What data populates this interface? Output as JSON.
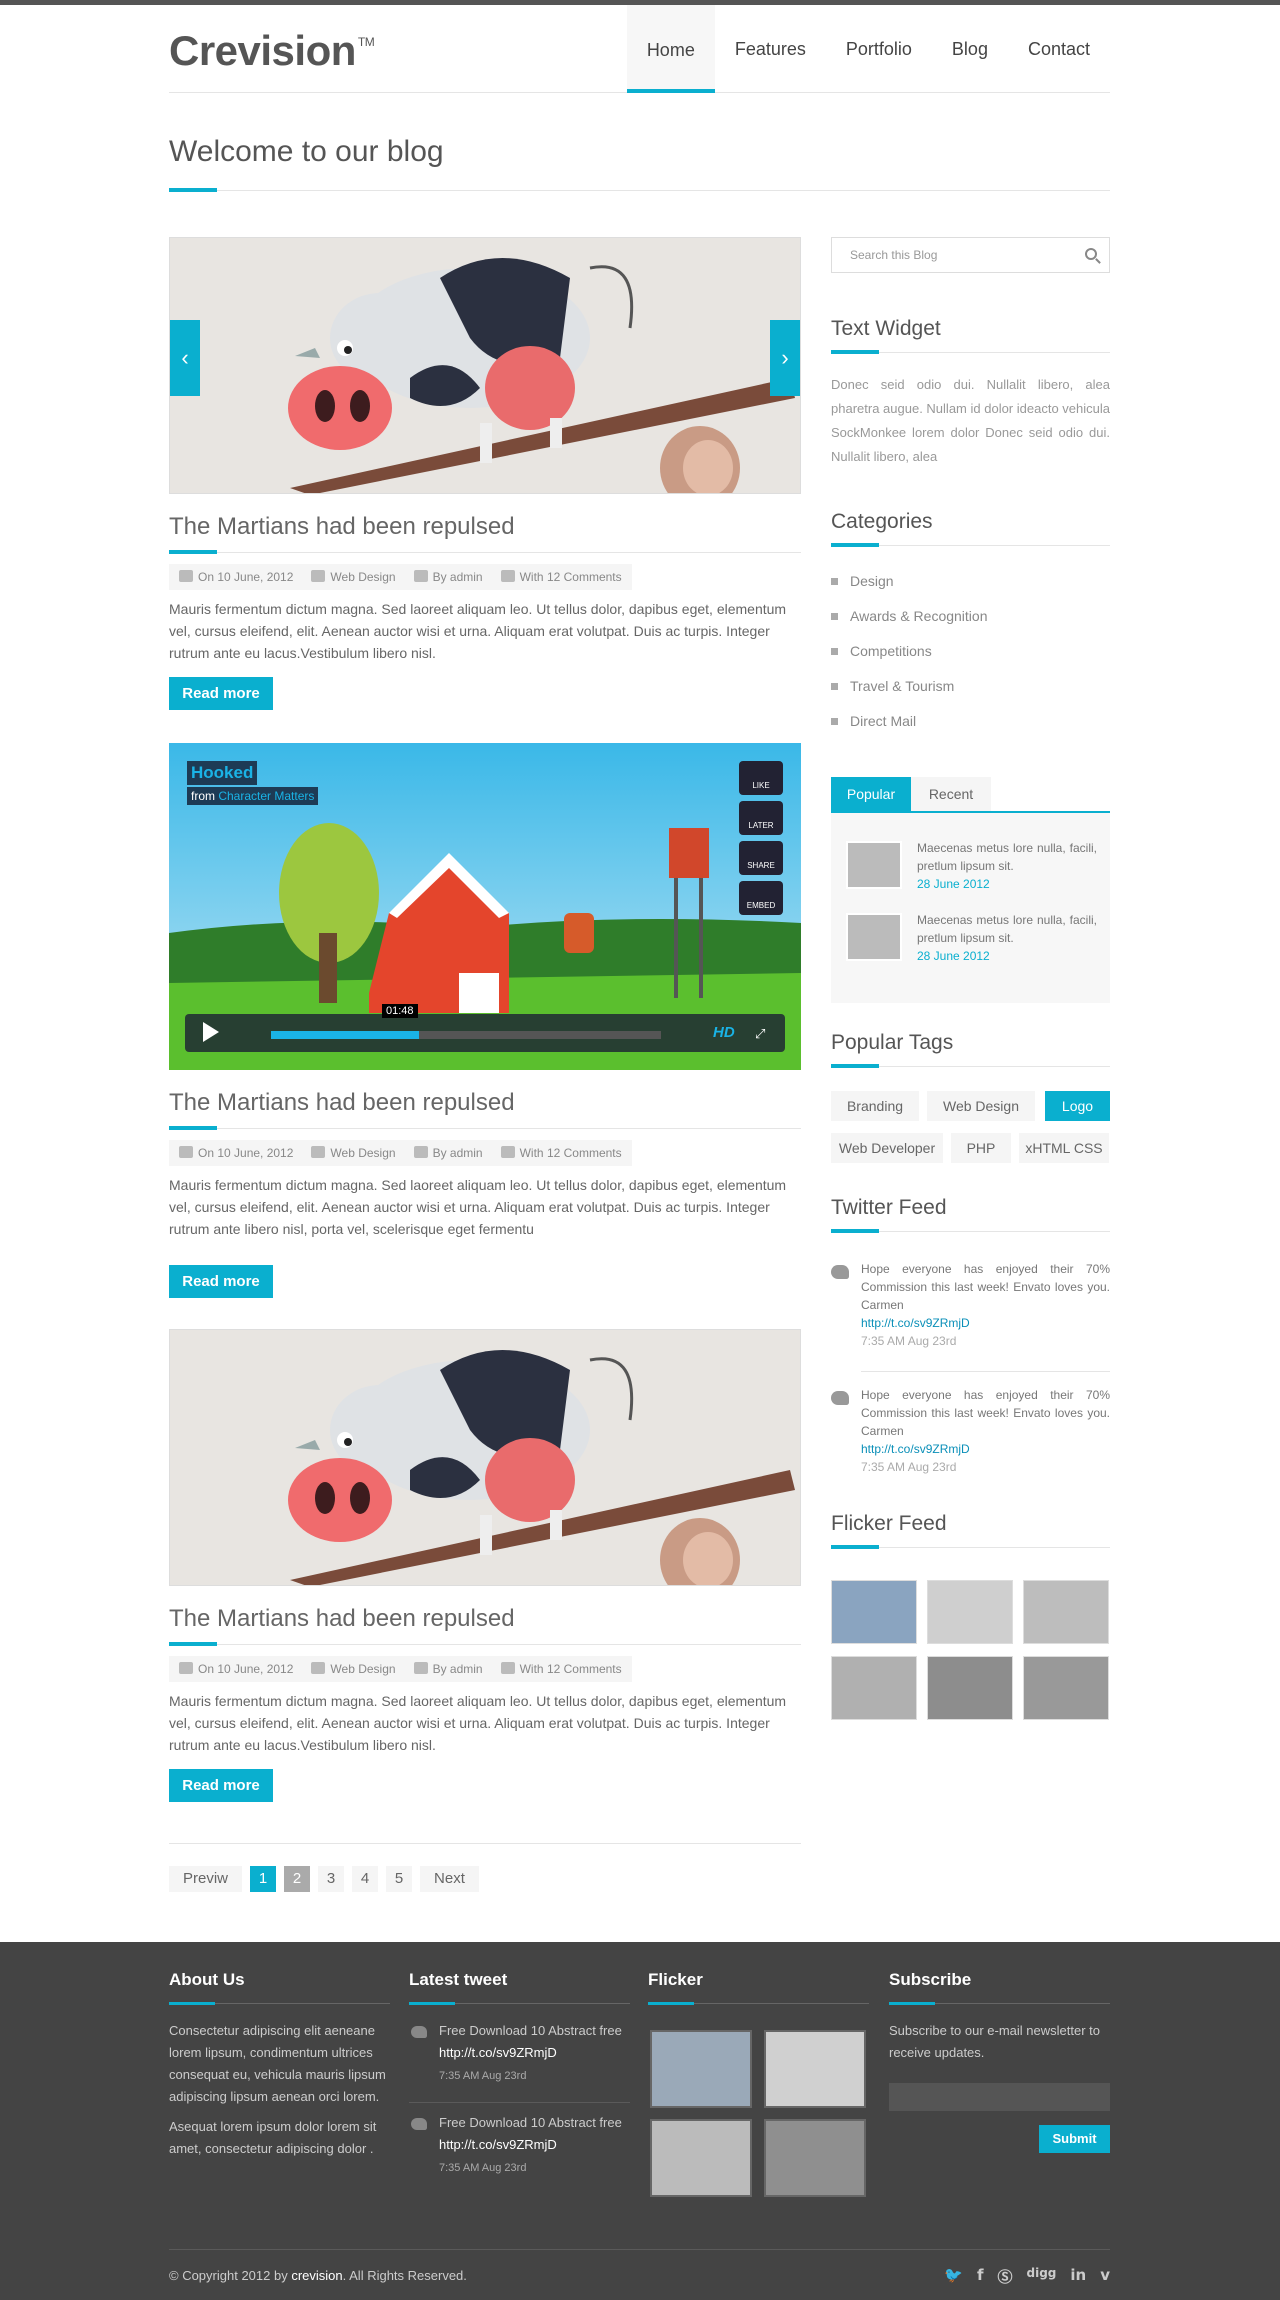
{
  "header": {
    "logo": "Crevision",
    "logo_mark": "TM",
    "nav": [
      "Home",
      "Features",
      "Portfolio",
      "Blog",
      "Contact"
    ],
    "active_nav": "Home"
  },
  "page_title": "Welcome to our blog",
  "posts": [
    {
      "title": "The Martians had been repulsed",
      "date": "On 10 June, 2012",
      "category": "Web Design",
      "author": "By admin",
      "comments": "With 12 Comments",
      "excerpt": "Mauris fermentum dictum magna. Sed laoreet aliquam leo. Ut tellus dolor, dapibus eget, elementum vel, cursus eleifend, elit. Aenean auctor wisi et urna. Aliquam erat volutpat. Duis ac turpis. Integer rutrum ante eu lacus.Vestibulum libero nisl.",
      "read_more": "Read more"
    },
    {
      "title": "The Martians had been repulsed",
      "date": "On 10 June, 2012",
      "category": "Web Design",
      "author": "By admin",
      "comments": "With 12 Comments",
      "excerpt": "Mauris fermentum dictum magna. Sed laoreet aliquam leo. Ut tellus dolor, dapibus eget, elementum vel, cursus eleifend, elit. Aenean auctor wisi et urna. Aliquam erat volutpat. Duis ac turpis. Integer rutrum ante libero nisl, porta vel, scelerisque eget fermentu",
      "read_more": "Read more",
      "video": {
        "title": "Hooked",
        "from": "from",
        "channel": "Character Matters",
        "time": "01:48",
        "buttons": [
          "LIKE",
          "LATER",
          "SHARE",
          "EMBED"
        ],
        "hd": "HD"
      }
    },
    {
      "title": "The Martians had been repulsed",
      "date": "On 10 June, 2012",
      "category": "Web Design",
      "author": "By admin",
      "comments": "With 12 Comments",
      "excerpt": "Mauris fermentum dictum magna. Sed laoreet aliquam leo. Ut tellus dolor, dapibus eget, elementum vel, cursus eleifend, elit. Aenean auctor wisi et urna. Aliquam erat volutpat. Duis ac turpis. Integer rutrum ante eu lacus.Vestibulum libero nisl.",
      "read_more": "Read more"
    }
  ],
  "pagination": {
    "prev": "Previw",
    "pages": [
      "1",
      "2",
      "3",
      "4",
      "5"
    ],
    "next": "Next",
    "current": 1
  },
  "sidebar": {
    "search_placeholder": "Search this Blog",
    "text_widget": {
      "title": "Text Widget",
      "text": "Donec seid odio dui. Nullalit libero, alea pharetra augue. Nullam id dolor ideacto vehicula SockMonkee lorem dolor Donec seid odio dui. Nullalit libero, alea"
    },
    "categories": {
      "title": "Categories",
      "items": [
        "Design",
        "Awards & Recognition",
        "Competitions",
        "Travel & Tourism",
        "Direct Mail"
      ]
    },
    "tabs": {
      "items": [
        "Popular",
        "Recent"
      ],
      "posts": [
        {
          "text": "Maecenas metus lore nulla, facili, pretlum lipsum sit.",
          "date": "28 June 2012"
        },
        {
          "text": "Maecenas metus lore nulla, facili, pretlum lipsum sit.",
          "date": "28 June 2012"
        }
      ]
    },
    "tags": {
      "title": "Popular Tags",
      "items": [
        "Branding",
        "Web Design",
        "Logo",
        "Web Developer",
        "PHP",
        "xHTML CSS"
      ],
      "active": "Logo"
    },
    "twitter": {
      "title": "Twitter Feed",
      "tweets": [
        {
          "text": "Hope everyone has enjoyed their 70% Commission this last week! Envato loves you. Carmen",
          "link": "http://t.co/sv9ZRmjD",
          "time": "7:35 AM Aug 23rd"
        },
        {
          "text": "Hope everyone has enjoyed their 70% Commission this last week! Envato loves you. Carmen",
          "link": "http://t.co/sv9ZRmjD",
          "time": "7:35 AM Aug 23rd"
        }
      ]
    },
    "flicker": {
      "title": "Flicker Feed"
    }
  },
  "footer": {
    "about": {
      "title": "About Us",
      "p1": "Consectetur adipiscing elit aeneane lorem lipsum, condimentum ultrices consequat eu, vehicula mauris lipsum adipiscing lipsum aenean orci lorem.",
      "p2": "Asequat lorem ipsum dolor lorem sit amet, consectetur adipiscing dolor ."
    },
    "tweets": {
      "title": "Latest tweet",
      "items": [
        {
          "text": "Free Download 10 Abstract free",
          "link": "http://t.co/sv9ZRmjD",
          "time": "7:35 AM Aug 23rd"
        },
        {
          "text": "Free Download 10 Abstract free",
          "link": "http://t.co/sv9ZRmjD",
          "time": "7:35 AM Aug 23rd"
        }
      ]
    },
    "flicker": {
      "title": "Flicker"
    },
    "subscribe": {
      "title": "Subscribe",
      "text": "Subscribe to our e-mail newsletter to receive updates.",
      "button": "Submit"
    },
    "copyright_pre": "© Copyright 2012 by ",
    "copyright_brand": "crevision",
    "copyright_post": ". All Rights Reserved.",
    "social": [
      "twitter-icon",
      "facebook-icon",
      "skype-icon",
      "digg-icon",
      "linkedin-icon",
      "vimeo-icon"
    ],
    "social_labels": {
      "digg": "digg",
      "linkedin": "in",
      "facebook": "f",
      "vimeo": "v"
    }
  },
  "colors": {
    "accent": "#0aafcf",
    "footer_bg": "#444444"
  }
}
